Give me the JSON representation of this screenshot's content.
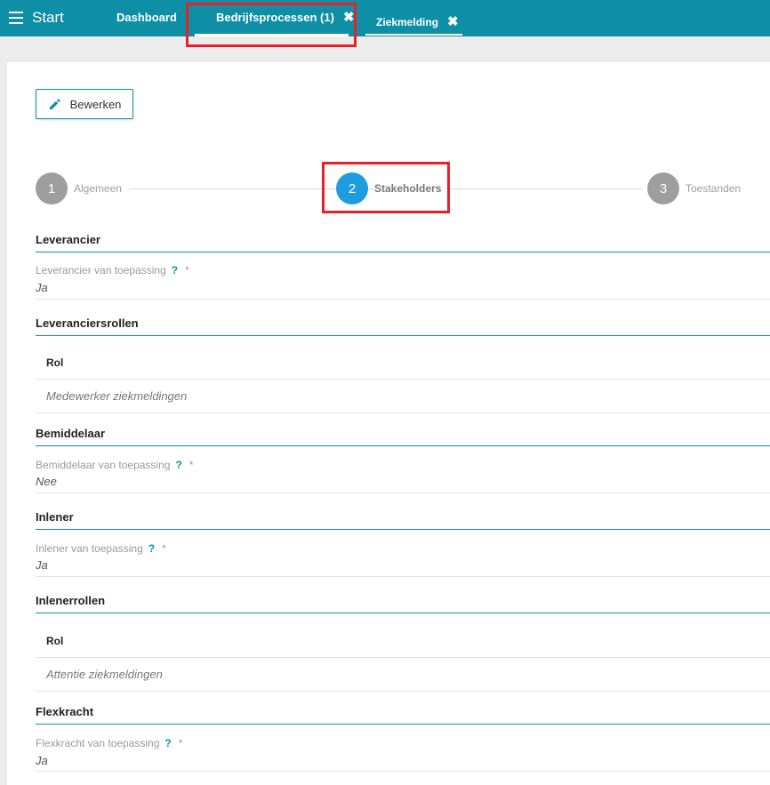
{
  "topbar": {
    "menu_label": "Start",
    "tabs": [
      {
        "label": "Dashboard"
      },
      {
        "label": "Bedrijfsprocessen (1)",
        "close": "✖"
      },
      {
        "label": "Ziekmelding",
        "close": "✖"
      }
    ]
  },
  "toolbar": {
    "edit_label": "Bewerken",
    "edit_icon": "pencil-icon"
  },
  "stepper": {
    "steps": [
      {
        "number": "1",
        "label": "Algemeen",
        "active": false
      },
      {
        "number": "2",
        "label": "Stakeholders",
        "active": true
      },
      {
        "number": "3",
        "label": "Toestanden",
        "active": false
      }
    ]
  },
  "sections": {
    "leverancier": {
      "title": "Leverancier",
      "field_label": "Leverancier van toepassing",
      "help": "?",
      "required": "*",
      "value": "Ja"
    },
    "leveranciersrollen": {
      "title": "Leveranciersrollen",
      "column": "Rol",
      "rows": [
        "Medewerker ziekmeldingen"
      ]
    },
    "bemiddelaar": {
      "title": "Bemiddelaar",
      "field_label": "Bemiddelaar van toepassing",
      "help": "?",
      "required": "*",
      "value": "Nee"
    },
    "inlener": {
      "title": "Inlener",
      "field_label": "Inlener van toepassing",
      "help": "?",
      "required": "*",
      "value": "Ja"
    },
    "inlenerrollen": {
      "title": "Inlenerrollen",
      "column": "Rol",
      "rows": [
        "Attentie ziekmeldingen"
      ]
    },
    "flexkracht": {
      "title": "Flexkracht",
      "field_label": "Flexkracht van toepassing",
      "help": "?",
      "required": "*",
      "value": "Ja"
    }
  },
  "colors": {
    "topbar": "#0e8fa5",
    "active_step": "#1d9ce0",
    "inactive_step": "#9e9e9e",
    "highlight": "#e8202a"
  }
}
